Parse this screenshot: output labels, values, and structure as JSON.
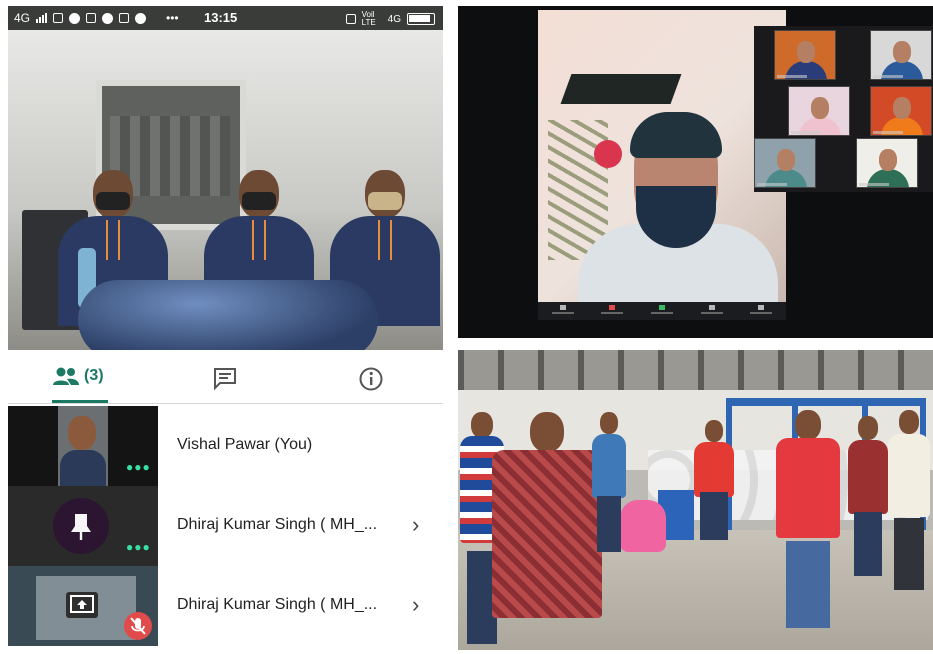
{
  "status_bar": {
    "signal": "4G",
    "time": "13:15",
    "volte": "Voil LTE",
    "network": "4G"
  },
  "tabs": {
    "people_count": "(3)"
  },
  "participants": [
    {
      "name": "Vishal Pawar (You)",
      "has_chevron": false
    },
    {
      "name": "Dhiraj Kumar Singh ( MH_...",
      "has_chevron": true
    },
    {
      "name": "Dhiraj Kumar Singh ( MH_...",
      "has_chevron": true
    }
  ],
  "icons": {
    "people": "people-icon",
    "chat": "chat-icon",
    "info": "info-icon",
    "pin": "pin-icon",
    "screen_share": "screen-share-icon",
    "muted": "mic-off-icon",
    "chevron": "chevron-right-icon"
  },
  "colors": {
    "accent": "#1c7a64",
    "status_bar": "#3a3c3a",
    "active_dots": "#36e0a2",
    "muted_badge": "#e14b4b",
    "pin_avatar": "#2b1530"
  }
}
